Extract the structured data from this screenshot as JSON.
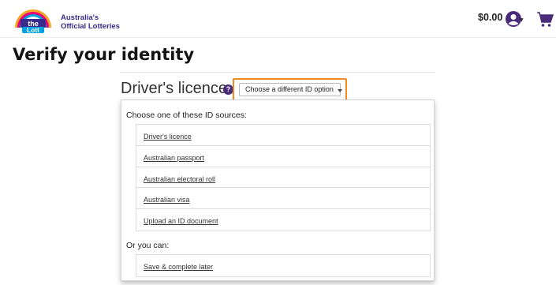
{
  "header": {
    "logo": {
      "icon": "the-lott-logo",
      "line1": "the",
      "line2": "Lott"
    },
    "brand_line1": "Australia's",
    "brand_line2": "Official Lotteries",
    "balance": "$0.00",
    "account_icon": "user-circle-icon",
    "cart_icon": "cart-icon"
  },
  "page_title": "Verify your identity",
  "id_section": {
    "title": "Driver's licence",
    "help_icon_text": "?",
    "choose_button": "Choose a different ID option"
  },
  "dropdown": {
    "sources_heading": "Choose one of these ID sources:",
    "sources": [
      "Driver's licence",
      "Australian passport",
      "Australian electoral roll",
      "Australian visa",
      "Upload an ID document"
    ],
    "alt_heading": "Or you can:",
    "alt_options": [
      "Save & complete later"
    ]
  },
  "colors": {
    "brand_purple": "#3a2a8c",
    "icon_purple": "#4a2a7a",
    "highlight_orange": "#f08a24"
  }
}
